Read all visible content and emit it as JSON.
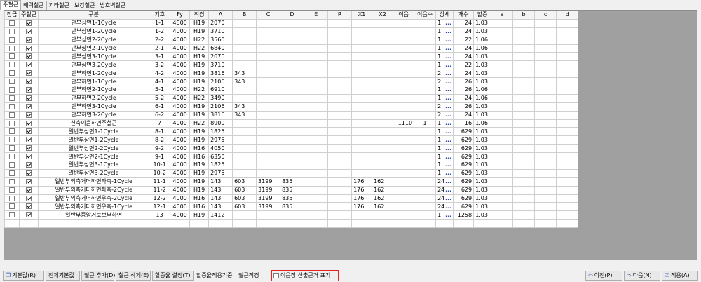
{
  "tabs": [
    "주철근",
    "배력철근",
    "기타철근",
    "보강철근",
    "방호벽철근"
  ],
  "columns": [
    "장금",
    "주철근",
    "구분",
    "기호",
    "Fy",
    "직경",
    "A",
    "B",
    "C",
    "D",
    "E",
    "R",
    "X1",
    "X2",
    "이음",
    "이음수",
    "상세",
    "개수",
    "할증",
    "a",
    "b",
    "c",
    "d"
  ],
  "rows": [
    {
      "lock": false,
      "main": true,
      "name": "단부상면1-1Cycle",
      "sym": "1-1",
      "fy": "4000",
      "dia": "H19",
      "A": "2070",
      "B": "",
      "C": "",
      "D": "",
      "E": "",
      "R": "",
      "X1": "",
      "X2": "",
      "joint": "",
      "jcnt": "",
      "det": "1",
      "cnt": "24",
      "ext": "1.03"
    },
    {
      "lock": false,
      "main": true,
      "name": "단부상면1-2Cycle",
      "sym": "1-2",
      "fy": "4000",
      "dia": "H19",
      "A": "3710",
      "B": "",
      "C": "",
      "D": "",
      "E": "",
      "R": "",
      "X1": "",
      "X2": "",
      "joint": "",
      "jcnt": "",
      "det": "1",
      "cnt": "24",
      "ext": "1.03"
    },
    {
      "lock": false,
      "main": true,
      "name": "단부상면2-2Cycle",
      "sym": "2-2",
      "fy": "4000",
      "dia": "H22",
      "A": "3560",
      "B": "",
      "C": "",
      "D": "",
      "E": "",
      "R": "",
      "X1": "",
      "X2": "",
      "joint": "",
      "jcnt": "",
      "det": "1",
      "cnt": "22",
      "ext": "1.06"
    },
    {
      "lock": false,
      "main": true,
      "name": "단부상면2-1Cycle",
      "sym": "2-1",
      "fy": "4000",
      "dia": "H22",
      "A": "6840",
      "B": "",
      "C": "",
      "D": "",
      "E": "",
      "R": "",
      "X1": "",
      "X2": "",
      "joint": "",
      "jcnt": "",
      "det": "1",
      "cnt": "24",
      "ext": "1.06"
    },
    {
      "lock": false,
      "main": true,
      "name": "단부상면3-1Cycle",
      "sym": "3-1",
      "fy": "4000",
      "dia": "H19",
      "A": "2070",
      "B": "",
      "C": "",
      "D": "",
      "E": "",
      "R": "",
      "X1": "",
      "X2": "",
      "joint": "",
      "jcnt": "",
      "det": "1",
      "cnt": "24",
      "ext": "1.03"
    },
    {
      "lock": false,
      "main": true,
      "name": "단부상면3-2Cycle",
      "sym": "3-2",
      "fy": "4000",
      "dia": "H19",
      "A": "3710",
      "B": "",
      "C": "",
      "D": "",
      "E": "",
      "R": "",
      "X1": "",
      "X2": "",
      "joint": "",
      "jcnt": "",
      "det": "1",
      "cnt": "22",
      "ext": "1.03"
    },
    {
      "lock": false,
      "main": true,
      "name": "단부하면1-2Cycle",
      "sym": "4-2",
      "fy": "4000",
      "dia": "H19",
      "A": "3816",
      "B": "343",
      "C": "",
      "D": "",
      "E": "",
      "R": "",
      "X1": "",
      "X2": "",
      "joint": "",
      "jcnt": "",
      "det": "2",
      "cnt": "24",
      "ext": "1.03"
    },
    {
      "lock": false,
      "main": true,
      "name": "단부하면1-1Cycle",
      "sym": "4-1",
      "fy": "4000",
      "dia": "H19",
      "A": "2106",
      "B": "343",
      "C": "",
      "D": "",
      "E": "",
      "R": "",
      "X1": "",
      "X2": "",
      "joint": "",
      "jcnt": "",
      "det": "2",
      "cnt": "26",
      "ext": "1.03"
    },
    {
      "lock": false,
      "main": true,
      "name": "단부하면2-1Cycle",
      "sym": "5-1",
      "fy": "4000",
      "dia": "H22",
      "A": "6910",
      "B": "",
      "C": "",
      "D": "",
      "E": "",
      "R": "",
      "X1": "",
      "X2": "",
      "joint": "",
      "jcnt": "",
      "det": "1",
      "cnt": "26",
      "ext": "1.06"
    },
    {
      "lock": false,
      "main": true,
      "name": "단부하면2-2Cycle",
      "sym": "5-2",
      "fy": "4000",
      "dia": "H22",
      "A": "3490",
      "B": "",
      "C": "",
      "D": "",
      "E": "",
      "R": "",
      "X1": "",
      "X2": "",
      "joint": "",
      "jcnt": "",
      "det": "1",
      "cnt": "24",
      "ext": "1.06"
    },
    {
      "lock": false,
      "main": true,
      "name": "단부하면3-1Cycle",
      "sym": "6-1",
      "fy": "4000",
      "dia": "H19",
      "A": "2106",
      "B": "343",
      "C": "",
      "D": "",
      "E": "",
      "R": "",
      "X1": "",
      "X2": "",
      "joint": "",
      "jcnt": "",
      "det": "2",
      "cnt": "26",
      "ext": "1.03"
    },
    {
      "lock": false,
      "main": true,
      "name": "단부하면3-2Cycle",
      "sym": "6-2",
      "fy": "4000",
      "dia": "H19",
      "A": "3816",
      "B": "343",
      "C": "",
      "D": "",
      "E": "",
      "R": "",
      "X1": "",
      "X2": "",
      "joint": "",
      "jcnt": "",
      "det": "2",
      "cnt": "24",
      "ext": "1.03"
    },
    {
      "lock": false,
      "main": true,
      "name": "신축이음하면주철근",
      "sym": "7",
      "fy": "4000",
      "dia": "H22",
      "A": "8900",
      "B": "",
      "C": "",
      "D": "",
      "E": "",
      "R": "",
      "X1": "",
      "X2": "",
      "joint": "1110",
      "jcnt": "1",
      "det": "1",
      "cnt": "16",
      "ext": "1.06"
    },
    {
      "lock": false,
      "main": true,
      "name": "일반부상면1-1Cycle",
      "sym": "8-1",
      "fy": "4000",
      "dia": "H19",
      "A": "1825",
      "B": "",
      "C": "",
      "D": "",
      "E": "",
      "R": "",
      "X1": "",
      "X2": "",
      "joint": "",
      "jcnt": "",
      "det": "1",
      "cnt": "629",
      "ext": "1.03"
    },
    {
      "lock": false,
      "main": true,
      "name": "일반부상면1-2Cycle",
      "sym": "8-2",
      "fy": "4000",
      "dia": "H19",
      "A": "2975",
      "B": "",
      "C": "",
      "D": "",
      "E": "",
      "R": "",
      "X1": "",
      "X2": "",
      "joint": "",
      "jcnt": "",
      "det": "1",
      "cnt": "629",
      "ext": "1.03"
    },
    {
      "lock": false,
      "main": true,
      "name": "일반부상면2-2Cycle",
      "sym": "9-2",
      "fy": "4000",
      "dia": "H16",
      "A": "4050",
      "B": "",
      "C": "",
      "D": "",
      "E": "",
      "R": "",
      "X1": "",
      "X2": "",
      "joint": "",
      "jcnt": "",
      "det": "1",
      "cnt": "629",
      "ext": "1.03"
    },
    {
      "lock": false,
      "main": true,
      "name": "일반부상면2-1Cycle",
      "sym": "9-1",
      "fy": "4000",
      "dia": "H16",
      "A": "6350",
      "B": "",
      "C": "",
      "D": "",
      "E": "",
      "R": "",
      "X1": "",
      "X2": "",
      "joint": "",
      "jcnt": "",
      "det": "1",
      "cnt": "629",
      "ext": "1.03"
    },
    {
      "lock": false,
      "main": true,
      "name": "일반부상면3-1Cycle",
      "sym": "10-1",
      "fy": "4000",
      "dia": "H19",
      "A": "1825",
      "B": "",
      "C": "",
      "D": "",
      "E": "",
      "R": "",
      "X1": "",
      "X2": "",
      "joint": "",
      "jcnt": "",
      "det": "1",
      "cnt": "629",
      "ext": "1.03"
    },
    {
      "lock": false,
      "main": true,
      "name": "일반부상면3-2Cycle",
      "sym": "10-2",
      "fy": "4000",
      "dia": "H19",
      "A": "2975",
      "B": "",
      "C": "",
      "D": "",
      "E": "",
      "R": "",
      "X1": "",
      "X2": "",
      "joint": "",
      "jcnt": "",
      "det": "1",
      "cnt": "629",
      "ext": "1.03"
    },
    {
      "lock": false,
      "main": true,
      "name": "일반부외측거더하면좌측-1Cycle",
      "sym": "11-1",
      "fy": "4000",
      "dia": "H19",
      "A": "143",
      "B": "603",
      "C": "3199",
      "D": "835",
      "E": "",
      "R": "",
      "X1": "176",
      "X2": "162",
      "joint": "",
      "jcnt": "",
      "det": "24",
      "cnt": "629",
      "ext": "1.03"
    },
    {
      "lock": false,
      "main": true,
      "name": "일반부외측거더하면좌측-2Cycle",
      "sym": "11-2",
      "fy": "4000",
      "dia": "H19",
      "A": "143",
      "B": "603",
      "C": "3199",
      "D": "835",
      "E": "",
      "R": "",
      "X1": "176",
      "X2": "162",
      "joint": "",
      "jcnt": "",
      "det": "24",
      "cnt": "629",
      "ext": "1.03"
    },
    {
      "lock": false,
      "main": true,
      "name": "일반부외측거더하면우측-2Cycle",
      "sym": "12-2",
      "fy": "4000",
      "dia": "H16",
      "A": "143",
      "B": "603",
      "C": "3199",
      "D": "835",
      "E": "",
      "R": "",
      "X1": "176",
      "X2": "162",
      "joint": "",
      "jcnt": "",
      "det": "24",
      "cnt": "629",
      "ext": "1.03"
    },
    {
      "lock": false,
      "main": true,
      "name": "일반부외측거더하면우측-1Cycle",
      "sym": "12-1",
      "fy": "4000",
      "dia": "H16",
      "A": "143",
      "B": "603",
      "C": "3199",
      "D": "835",
      "E": "",
      "R": "",
      "X1": "176",
      "X2": "162",
      "joint": "",
      "jcnt": "",
      "det": "24",
      "cnt": "629",
      "ext": "1.03"
    },
    {
      "lock": false,
      "main": true,
      "name": "일반부중앙거로보부하면",
      "sym": "13",
      "fy": "4000",
      "dia": "H19",
      "A": "1412",
      "B": "",
      "C": "",
      "D": "",
      "E": "",
      "R": "",
      "X1": "",
      "X2": "",
      "joint": "",
      "jcnt": "",
      "det": "1",
      "cnt": "1258",
      "ext": "1.03"
    }
  ],
  "detail_dots": "...",
  "toolbar": {
    "default_btn": "기본값(R)",
    "all_default_btn": "전체기본값",
    "add_btn": "철근 추가(D)",
    "delete_btn": "철근 삭제(E)",
    "extra_btn": "할증율 설정(T)",
    "extra_label": "할증율적용기준",
    "dia_label": "철근직경",
    "joint_check_label": "이음장 산출근거 표기",
    "prev_btn": "이전(P)",
    "next_btn": "다음(N)",
    "apply_btn": "적용(A)"
  }
}
